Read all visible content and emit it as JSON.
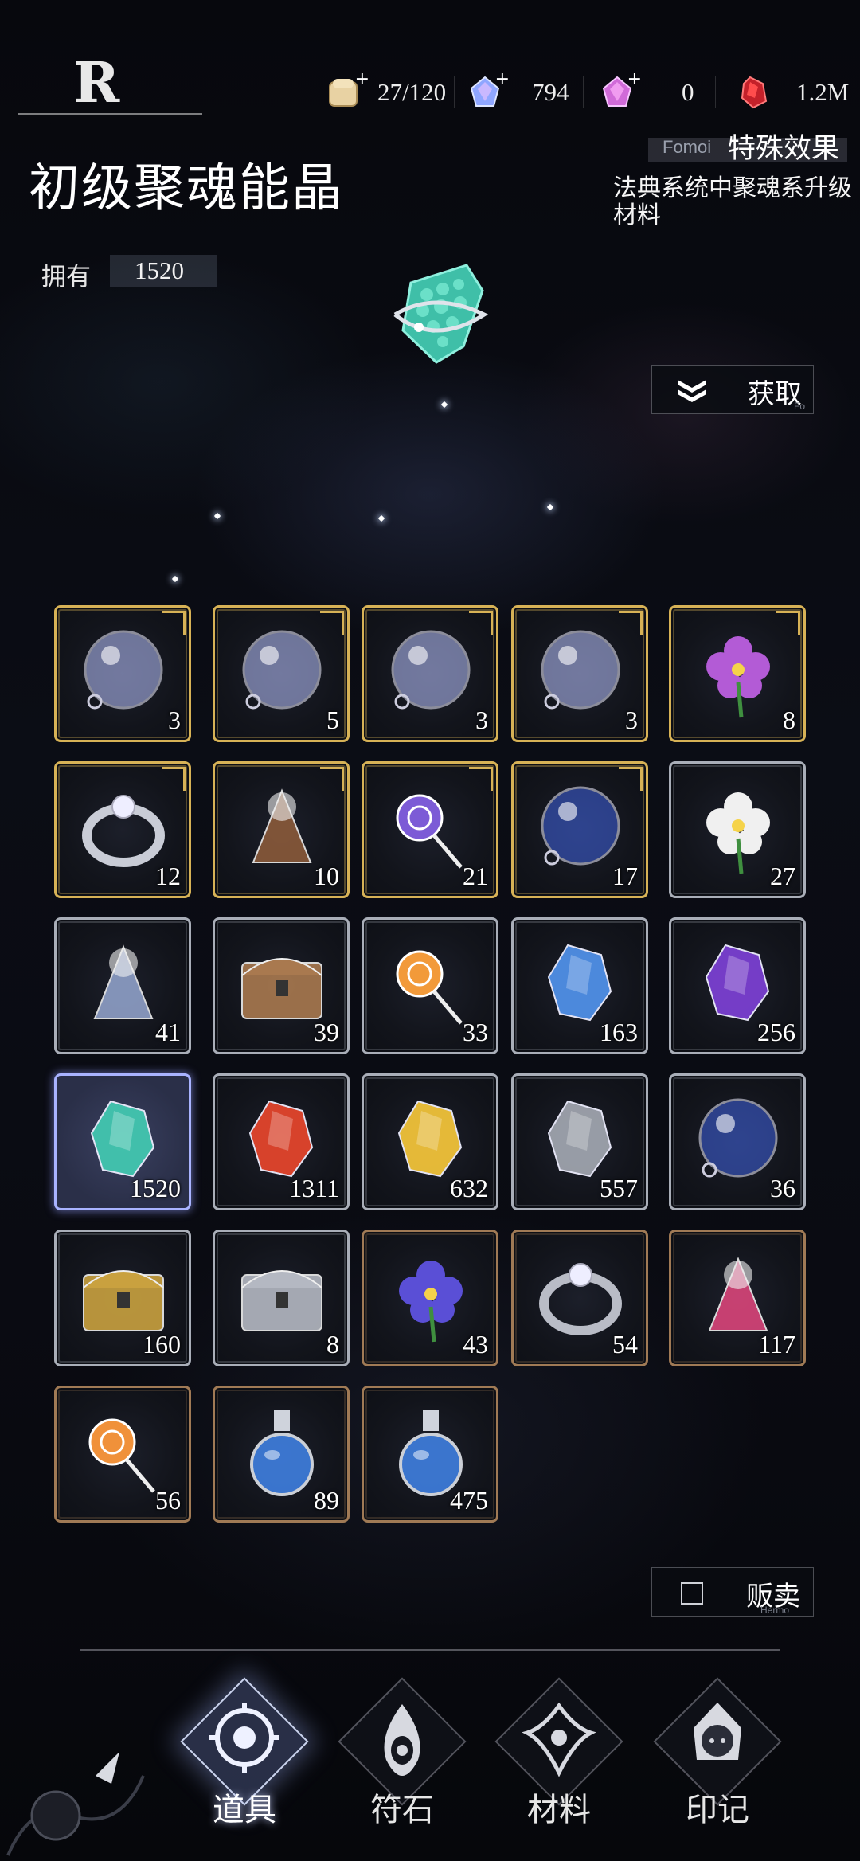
{
  "header": {
    "logo": "R",
    "resources": [
      {
        "icon": "bread-stamina-icon",
        "value": "27/120"
      },
      {
        "icon": "blue-gem-icon",
        "value": "794"
      },
      {
        "icon": "pink-gem-icon",
        "value": "0"
      },
      {
        "icon": "red-crystal-icon",
        "value": "1.2M"
      }
    ]
  },
  "item": {
    "name": "初级聚魂能晶",
    "owned_label": "拥有",
    "owned_value": "1520",
    "effect_sublabel": "Fomoi",
    "effect_title": "特殊效果",
    "effect_desc": "法典系统中聚魂系升级材料"
  },
  "actions": {
    "get_label": "获取",
    "get_tiny": "Fo",
    "sell_label": "贩卖",
    "sell_tiny": "Hermo"
  },
  "inventory": [
    {
      "icon": "violin-orb-icon",
      "count": "3",
      "frame": "gold"
    },
    {
      "icon": "cello-orb-icon",
      "count": "5",
      "frame": "gold"
    },
    {
      "icon": "piano-orb-icon",
      "count": "3",
      "frame": "gold"
    },
    {
      "icon": "harp-orb-icon",
      "count": "3",
      "frame": "gold"
    },
    {
      "icon": "purple-flower-icon",
      "count": "8",
      "frame": "gold"
    },
    {
      "icon": "diamond-ring-icon",
      "count": "12",
      "frame": "gold"
    },
    {
      "icon": "cake-slice-icon",
      "count": "10",
      "frame": "gold"
    },
    {
      "icon": "wrapped-candy-icon",
      "count": "21",
      "frame": "gold"
    },
    {
      "icon": "spiked-orb-icon",
      "count": "17",
      "frame": "gold"
    },
    {
      "icon": "white-lily-icon",
      "count": "27",
      "frame": "silver"
    },
    {
      "icon": "chain-pendant-icon",
      "count": "41",
      "frame": "silver"
    },
    {
      "icon": "macaron-box-icon",
      "count": "39",
      "frame": "silver"
    },
    {
      "icon": "lollipop-icon",
      "count": "33",
      "frame": "silver"
    },
    {
      "icon": "blue-crystal-icon",
      "count": "163",
      "frame": "silver"
    },
    {
      "icon": "purple-crystal-icon",
      "count": "256",
      "frame": "silver"
    },
    {
      "icon": "teal-soul-crystal-icon",
      "count": "1520",
      "frame": "selected"
    },
    {
      "icon": "red-crystal-shard-icon",
      "count": "1311",
      "frame": "silver"
    },
    {
      "icon": "gold-crystal-icon",
      "count": "632",
      "frame": "silver"
    },
    {
      "icon": "silver-ore-icon",
      "count": "557",
      "frame": "silver"
    },
    {
      "icon": "dark-spiked-orb-icon",
      "count": "36",
      "frame": "silver"
    },
    {
      "icon": "gold-chest-icon",
      "count": "160",
      "frame": "silver"
    },
    {
      "icon": "silver-chest-icon",
      "count": "8",
      "frame": "silver"
    },
    {
      "icon": "iris-flower-icon",
      "count": "43",
      "frame": "bronze"
    },
    {
      "icon": "silver-bracelet-icon",
      "count": "54",
      "frame": "bronze"
    },
    {
      "icon": "ice-cream-cone-icon",
      "count": "117",
      "frame": "bronze"
    },
    {
      "icon": "candy-drops-icon",
      "count": "56",
      "frame": "bronze"
    },
    {
      "icon": "blue-potion-icon",
      "count": "89",
      "frame": "bronze"
    },
    {
      "icon": "blue-flask-icon",
      "count": "475",
      "frame": "bronze"
    }
  ],
  "nav": {
    "tabs": [
      {
        "label": "道具",
        "icon": "gear-emblem-icon",
        "active": true
      },
      {
        "label": "符石",
        "icon": "flame-eye-icon",
        "active": false
      },
      {
        "label": "材料",
        "icon": "ornament-icon",
        "active": false
      },
      {
        "label": "印记",
        "icon": "hooded-girl-icon",
        "active": false
      }
    ]
  }
}
